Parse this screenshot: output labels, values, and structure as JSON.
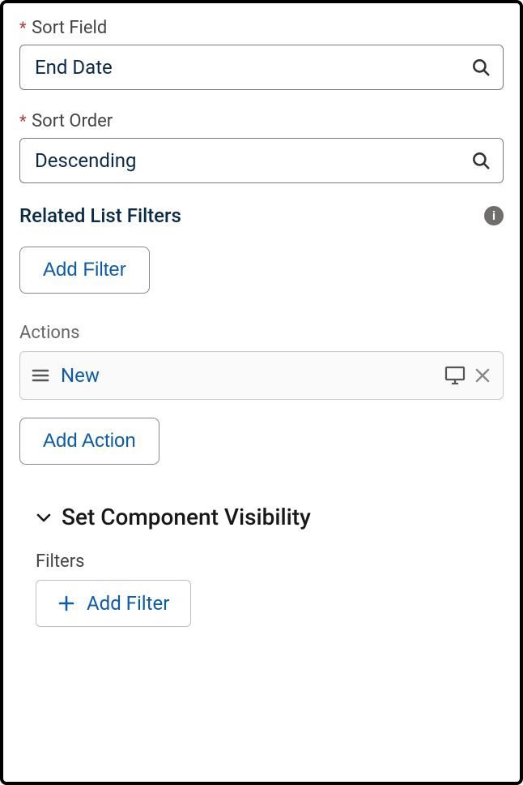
{
  "sortField": {
    "label": "Sort Field",
    "value": "End Date"
  },
  "sortOrder": {
    "label": "Sort Order",
    "value": "Descending"
  },
  "relatedListFilters": {
    "header": "Related List Filters",
    "addFilterLabel": "Add Filter"
  },
  "actions": {
    "label": "Actions",
    "items": [
      {
        "label": "New"
      }
    ],
    "addActionLabel": "Add Action"
  },
  "visibility": {
    "header": "Set Component Visibility",
    "filtersLabel": "Filters",
    "addFilterLabel": "Add Filter"
  }
}
